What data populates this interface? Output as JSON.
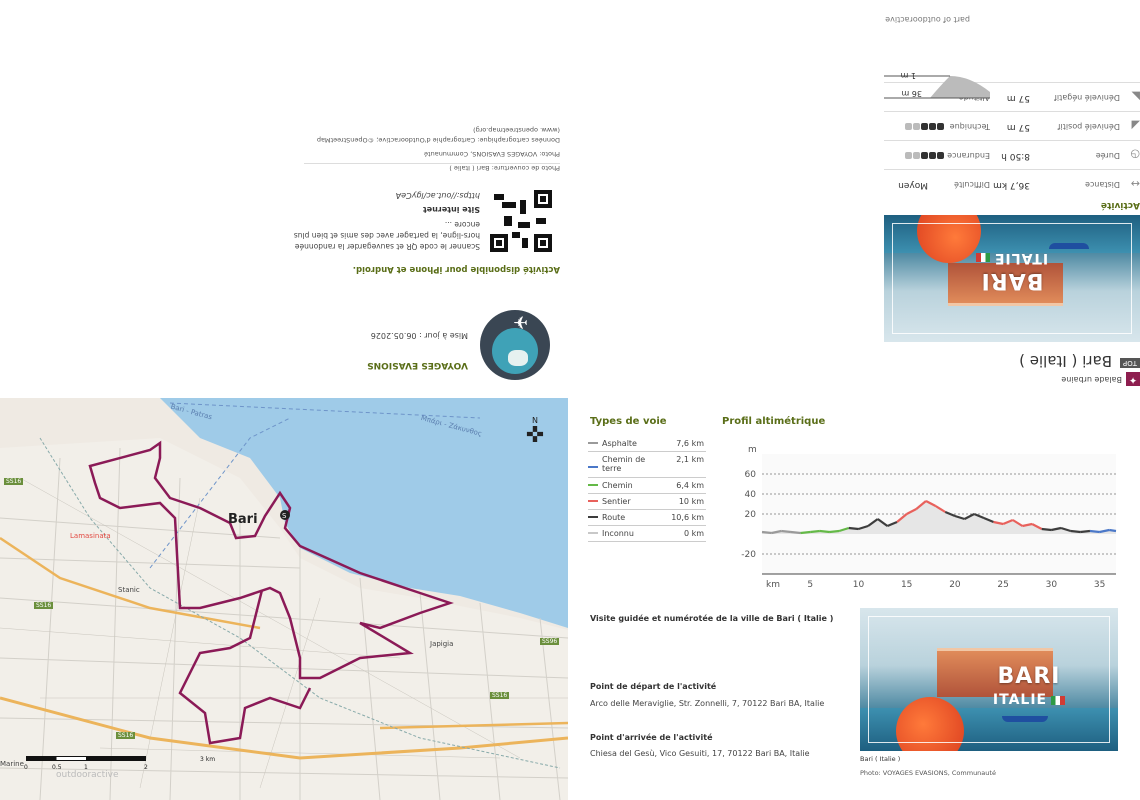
{
  "brand": {
    "tagline": "part of outdooractive"
  },
  "activity": {
    "type_label": "Balade urbaine",
    "top_badge": "TOP",
    "title": "Bari ( Italie )",
    "section_title": "Activité",
    "stats": [
      {
        "label": "Distance",
        "value": "36,7 km",
        "icon": "arrows-icon"
      },
      {
        "label": "Durée",
        "value": "8:50 h",
        "icon": "clock-icon"
      },
      {
        "label": "Dénivelé positif",
        "value": "57 m",
        "icon": "ascent-icon"
      },
      {
        "label": "Dénivelé négatif",
        "value": "57 m",
        "icon": "descent-icon"
      }
    ],
    "ratings": [
      {
        "label": "Difficulté",
        "value": "Moyen"
      },
      {
        "label": "Endurance",
        "filled": 3,
        "total": 5
      },
      {
        "label": "Technique",
        "filled": 3,
        "total": 5
      }
    ],
    "altitude_label": "Altitude",
    "altitude_max": "36 m",
    "altitude_min": "1 m"
  },
  "publisher": {
    "name": "VOYAGES EVASIONS",
    "updated": "Mise à jour : 06.05.2026"
  },
  "app_promo": {
    "title": "Activité disponible pour iPhone et Android.",
    "text": "Scanner le code QR et sauvegarder la randonnée hors-ligne, la partager avec des amis et bien plus encore ...",
    "website_label": "Site internet",
    "url": "https://out.ac/lgyCeA"
  },
  "credits": {
    "photo": "Photo de couverture: Bari ( Italie )",
    "photo_by": "Photo: VOYAGES EVASIONS, Communauté",
    "map_data": "Données cartographique: Cartographie d'Outdooractive; ©OpenStreetMap",
    "map_url": "(www. openstreetmap.org)",
    "bottom_photo": "Photo: VOYAGES EVASIONS, Communauté"
  },
  "cover": {
    "title": "BARI",
    "subtitle": "ITALIE"
  },
  "map": {
    "city_label": "Bari",
    "compass": "N",
    "scale_labels": [
      "0",
      "0.5",
      "1",
      "2",
      "3 km"
    ],
    "places": [
      "Stanic",
      "Japigia",
      "Marine",
      "Lamasinata"
    ],
    "roads": [
      "SS16",
      "SS16",
      "SS16",
      "SS16",
      "SS96"
    ],
    "sea_label": "Μπάρι - Ζάκυνθος",
    "sea_label2": "Bari - Patras",
    "watermark": "outdooractive"
  },
  "way_types": {
    "title": "Types de voie",
    "items": [
      {
        "name": "Asphalte",
        "km": "7,6 km",
        "color": "#9a9a9a"
      },
      {
        "name": "Chemin de terre",
        "km": "2,1 km",
        "color": "#4b78c8"
      },
      {
        "name": "Chemin",
        "km": "6,4 km",
        "color": "#64b947"
      },
      {
        "name": "Sentier",
        "km": "10 km",
        "color": "#e8615c"
      },
      {
        "name": "Route",
        "km": "10,6 km",
        "color": "#3d3d3d"
      },
      {
        "name": "Inconnu",
        "km": "0 km",
        "color": "#c8c8c8"
      }
    ]
  },
  "profile": {
    "title": "Profil altimétrique",
    "y_unit": "m",
    "x_unit": "km"
  },
  "chart_data": {
    "type": "area",
    "title": "Profil altimétrique",
    "xlabel": "km",
    "ylabel": "m",
    "x_ticks": [
      5,
      10,
      15,
      20,
      25,
      30,
      35
    ],
    "y_ticks": [
      -20,
      20,
      40,
      60
    ],
    "xlim": [
      0,
      36.7
    ],
    "ylim": [
      -40,
      80
    ],
    "x": [
      0,
      1,
      2,
      3,
      4,
      5,
      6,
      7,
      8,
      9,
      10,
      11,
      12,
      13,
      14,
      15,
      16,
      17,
      18,
      19,
      20,
      21,
      22,
      23,
      24,
      25,
      26,
      27,
      28,
      29,
      30,
      31,
      32,
      33,
      34,
      35,
      36,
      36.7
    ],
    "values": [
      2,
      1,
      3,
      2,
      1,
      2,
      3,
      2,
      3,
      6,
      5,
      8,
      15,
      8,
      12,
      20,
      25,
      33,
      28,
      22,
      18,
      15,
      20,
      16,
      12,
      10,
      14,
      8,
      10,
      5,
      4,
      6,
      3,
      2,
      3,
      2,
      4,
      3
    ]
  },
  "details": {
    "summary": "Visite guidée et numérotée de la ville de Bari ( Italie )",
    "start_label": "Point de départ de l'activité",
    "start_value": "Arco delle Meraviglie, Str. Zonnelli, 7, 70122 Bari BA, Italie",
    "end_label": "Point d'arrivée de l'activité",
    "end_value": "Chiesa del Gesù, Vico Gesuiti, 17, 70122 Bari BA, Italie",
    "caption": "Bari ( Italie )"
  }
}
